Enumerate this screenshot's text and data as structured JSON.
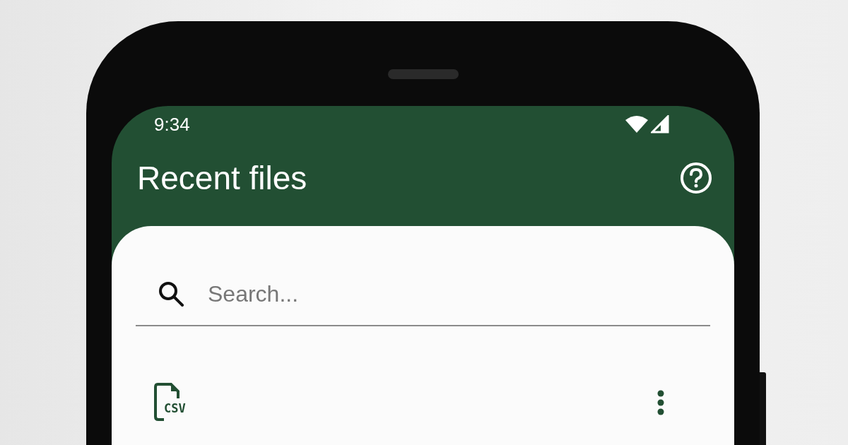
{
  "status_bar": {
    "time": "9:34"
  },
  "app_bar": {
    "title": "Recent files"
  },
  "search": {
    "placeholder": "Search..."
  },
  "files": [
    {
      "type_label": "CSV"
    }
  ]
}
